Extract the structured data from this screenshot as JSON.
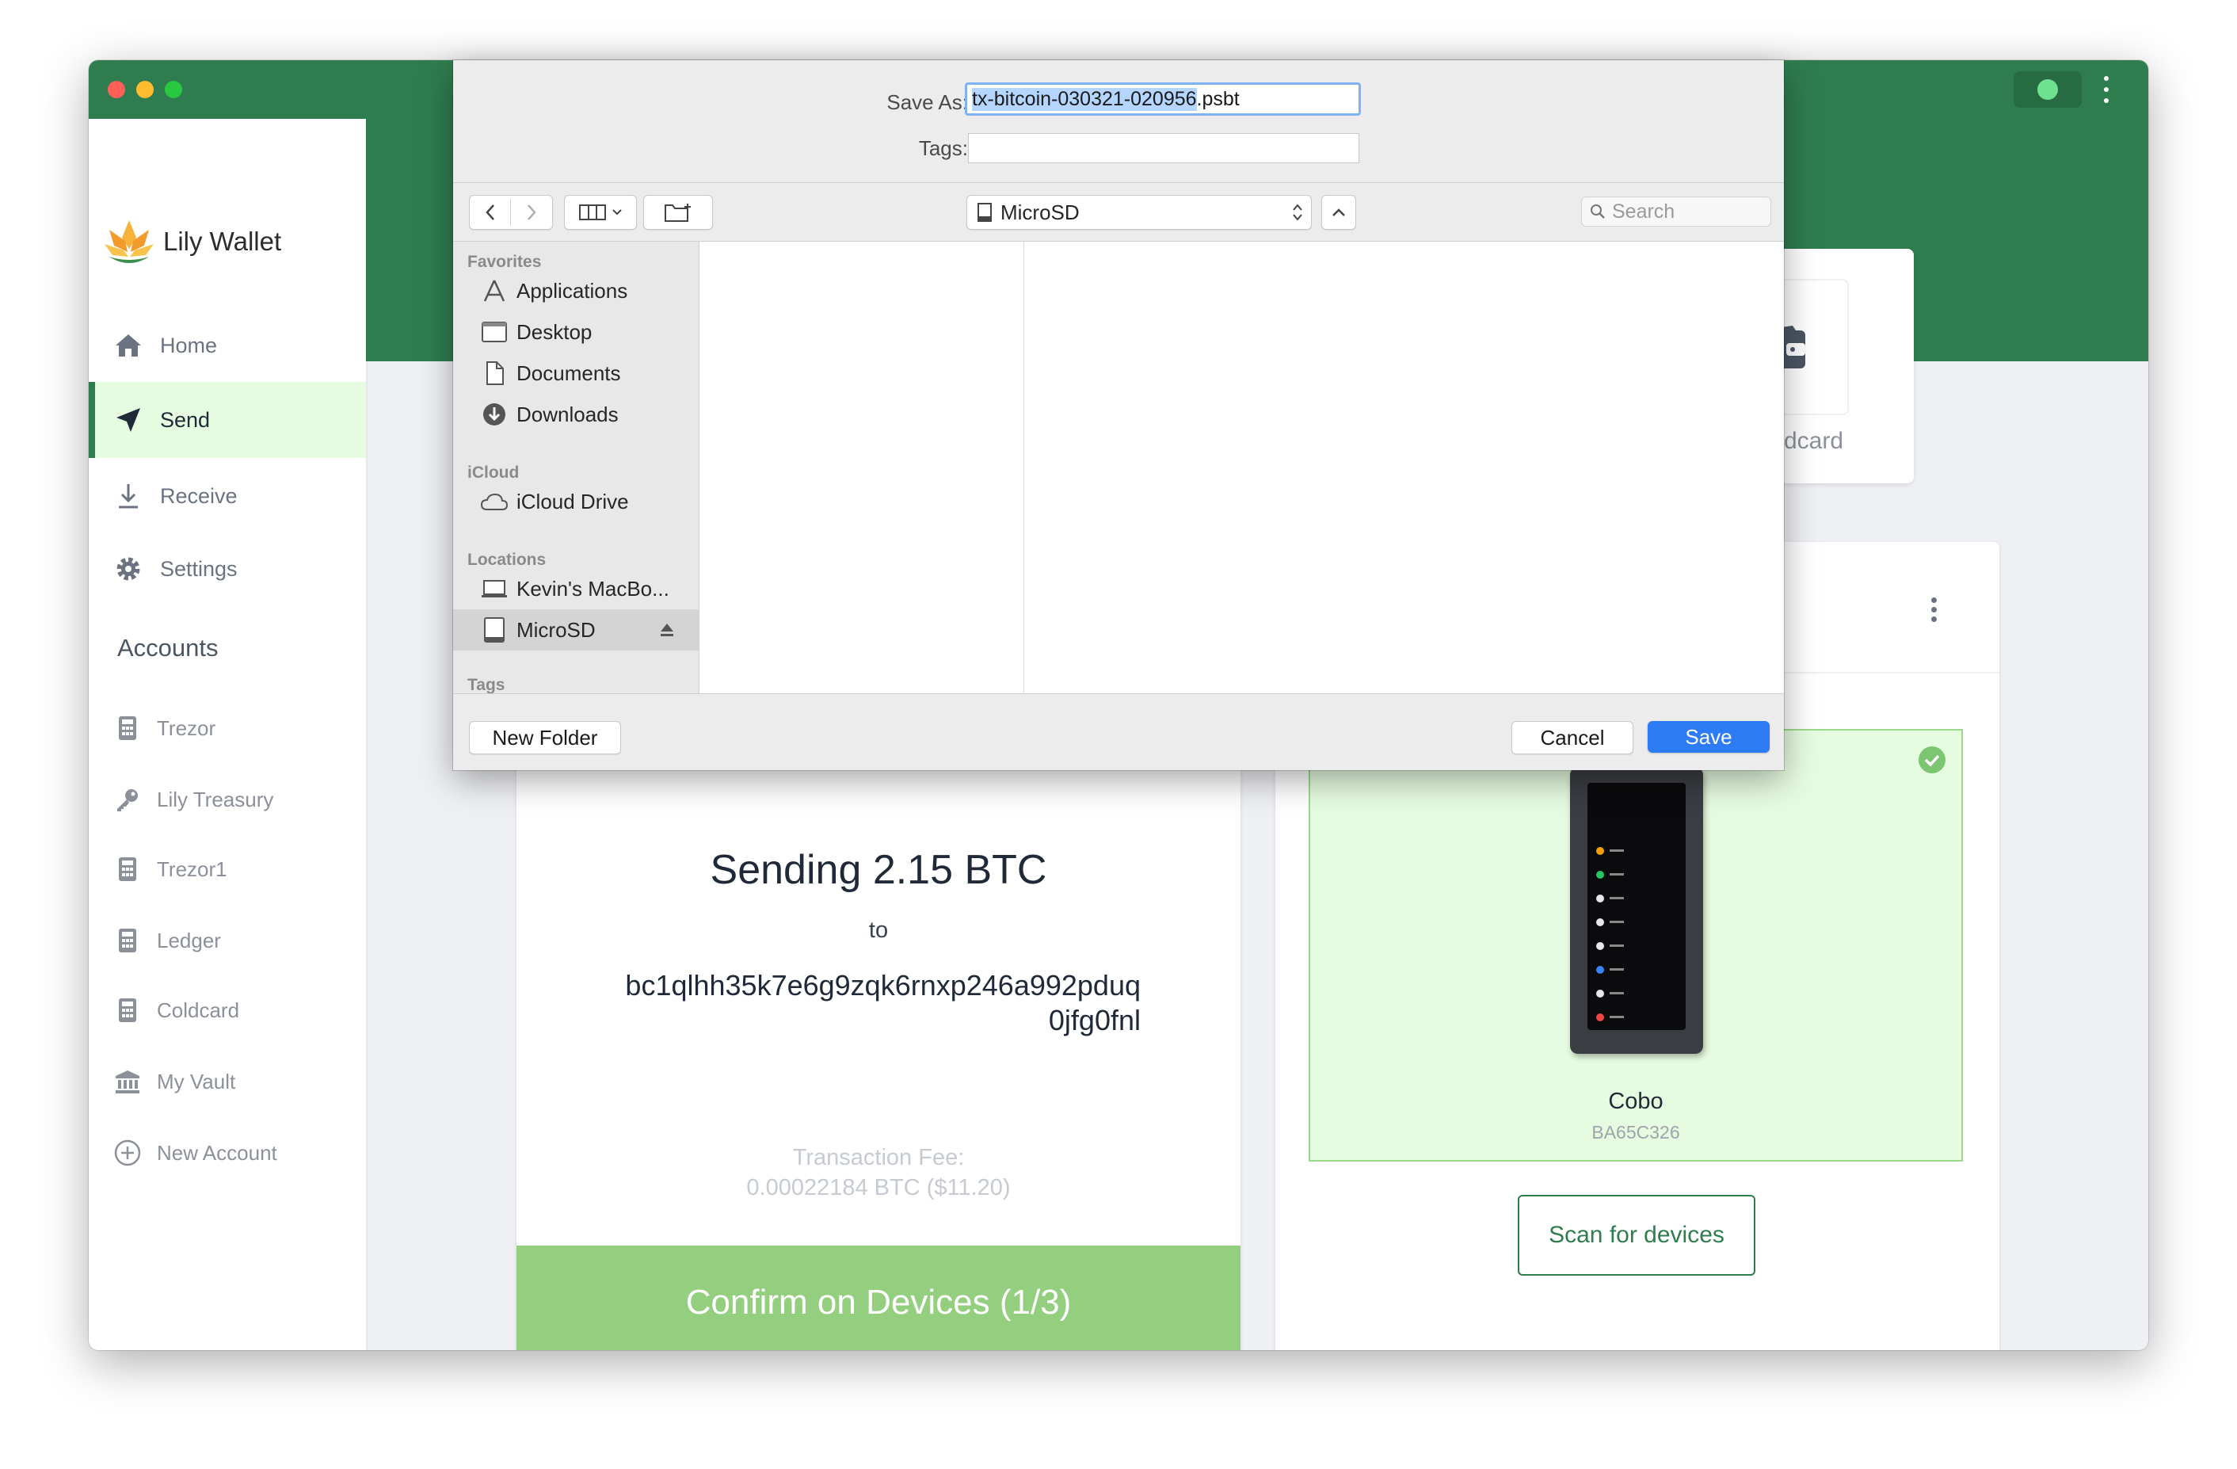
{
  "app": {
    "name": "Lily Wallet",
    "colors": {
      "brand_green": "#2f7d4f",
      "light_green": "#e6fce0",
      "confirm_green": "#93cf7e",
      "save_blue": "#2d7cf6"
    }
  },
  "sidebar": {
    "nav": [
      {
        "label": "Home",
        "icon": "home-icon"
      },
      {
        "label": "Send",
        "icon": "send-icon",
        "active": true
      },
      {
        "label": "Receive",
        "icon": "download-icon"
      },
      {
        "label": "Settings",
        "icon": "gear-icon"
      }
    ],
    "accounts_heading": "Accounts",
    "accounts": [
      {
        "label": "Trezor",
        "icon": "calculator-icon"
      },
      {
        "label": "Lily Treasury",
        "icon": "key-icon"
      },
      {
        "label": "Trezor1",
        "icon": "calculator-icon"
      },
      {
        "label": "Ledger",
        "icon": "calculator-icon"
      },
      {
        "label": "Coldcard",
        "icon": "calculator-icon"
      },
      {
        "label": "My Vault",
        "icon": "bank-icon"
      },
      {
        "label": "New Account",
        "icon": "plus-circle-icon"
      }
    ]
  },
  "send_card": {
    "sending_text": "Sending 2.15 BTC",
    "to_label": "to",
    "address_line1": "bc1qlhh35k7e6g9zqk6rnxp246a992pduq",
    "address_line2": "0jfg0fnl",
    "fee_label": "Transaction Fee:",
    "fee_value": "0.00022184 BTC ($11.20)",
    "confirm_button": "Confirm on Devices (1/3)"
  },
  "coldcard_card": {
    "label": "Coldcard",
    "icon": "wallet-icon"
  },
  "devices_panel": {
    "device_name": "Cobo",
    "device_fingerprint": "BA65C326",
    "scan_button": "Scan for devices"
  },
  "save_dialog": {
    "save_as_label": "Save As:",
    "filename_selected": "tx-bitcoin-030321-020956",
    "filename_ext": ".psbt",
    "tags_label": "Tags:",
    "tags_value": "",
    "location": "MicroSD",
    "search_placeholder": "Search",
    "favorites_heading": "Favorites",
    "favorites": [
      {
        "label": "Applications",
        "icon": "applications-icon"
      },
      {
        "label": "Desktop",
        "icon": "desktop-icon"
      },
      {
        "label": "Documents",
        "icon": "document-icon"
      },
      {
        "label": "Downloads",
        "icon": "download-circle-icon"
      }
    ],
    "icloud_heading": "iCloud",
    "icloud": [
      {
        "label": "iCloud Drive",
        "icon": "cloud-icon"
      }
    ],
    "locations_heading": "Locations",
    "locations": [
      {
        "label": "Kevin's MacBo...",
        "icon": "laptop-icon"
      },
      {
        "label": "MicroSD",
        "icon": "drive-icon",
        "selected": true
      }
    ],
    "tags_heading": "Tags",
    "new_folder_button": "New Folder",
    "cancel_button": "Cancel",
    "save_button": "Save"
  }
}
